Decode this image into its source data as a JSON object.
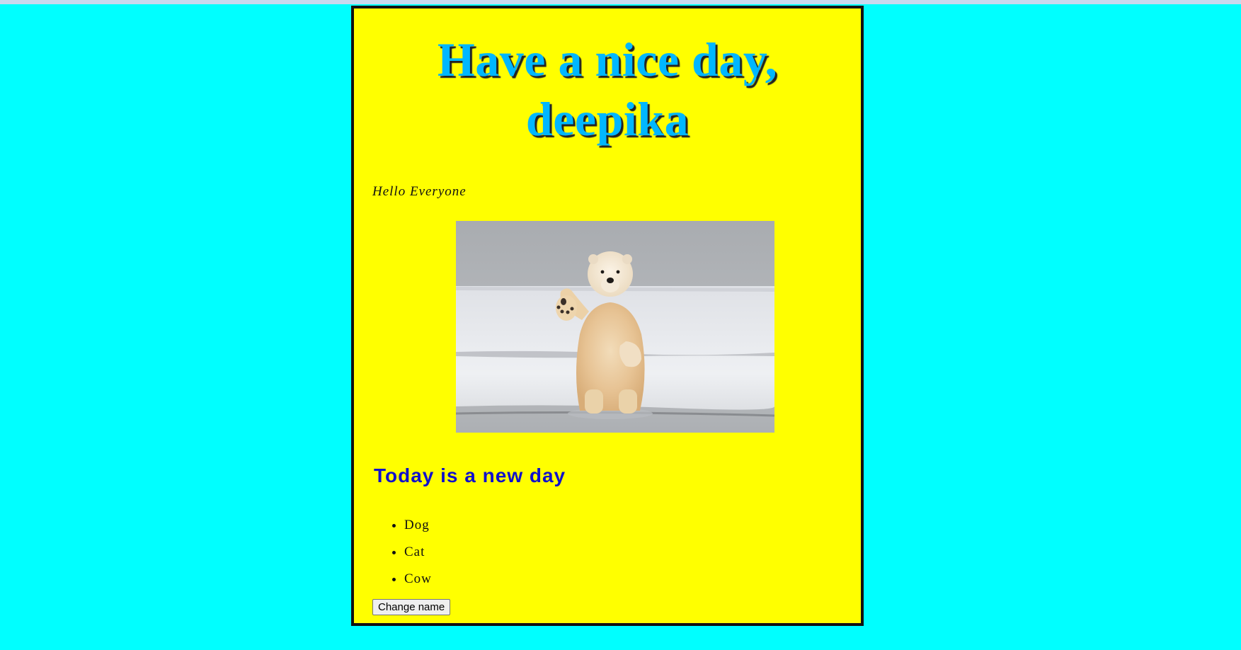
{
  "page": {
    "title": "Have a nice day, deepika",
    "greeting": "Hello Everyone",
    "subtitle": "Today is a new day",
    "animals": [
      "Dog",
      "Cat",
      "Cow"
    ],
    "button_label": "Change name",
    "image_icon": "polar-bear-waving-photo"
  },
  "colors": {
    "background": "#00ffff",
    "card": "#ffff00",
    "title": "#00b7ff",
    "subtitle": "#1010cc"
  }
}
